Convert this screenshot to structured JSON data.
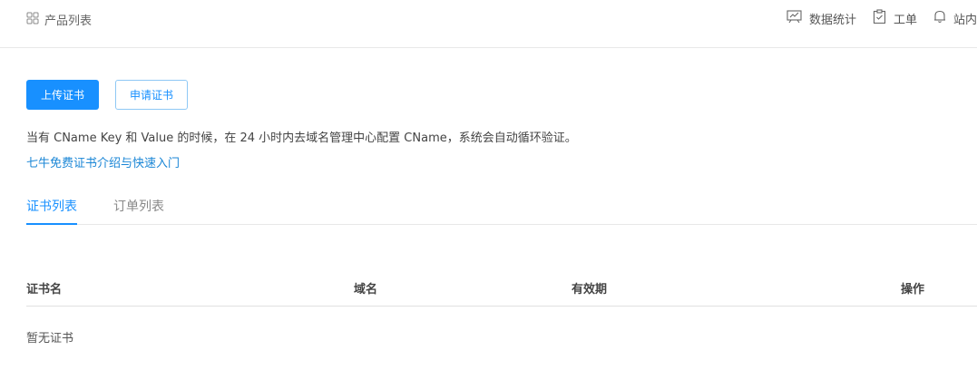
{
  "topbar": {
    "products_label": "产品列表",
    "stats_label": "数据统计",
    "ticket_label": "工单",
    "messages_label": "站内"
  },
  "actions": {
    "upload_label": "上传证书",
    "apply_label": "申请证书"
  },
  "notice_text": "当有 CName Key 和 Value 的时候，在 24 小时内去域名管理中心配置 CName，系统会自动循环验证。",
  "intro_link": "七牛免费证书介绍与快速入门",
  "tabs": [
    {
      "label": "证书列表",
      "active": true
    },
    {
      "label": "订单列表",
      "active": false
    }
  ],
  "table": {
    "columns": [
      "证书名",
      "域名",
      "有效期",
      "操作"
    ],
    "empty_text": "暂无证书"
  },
  "colors": {
    "accent": "#1890ff",
    "link": "#1a86d6"
  },
  "icons": {
    "products": "grid-icon",
    "stats": "chart-board-icon",
    "ticket": "clipboard-check-icon",
    "messages": "bell-icon"
  }
}
